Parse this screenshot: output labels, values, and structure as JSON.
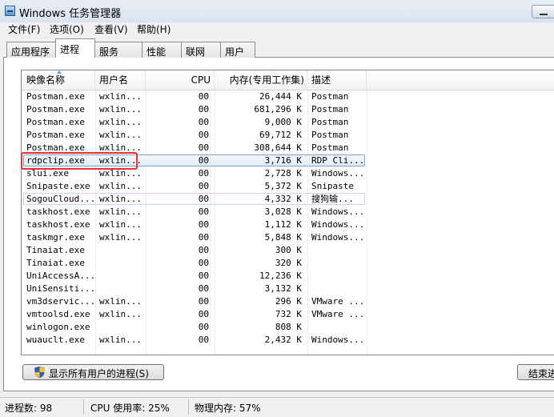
{
  "window": {
    "title": "Windows 任务管理器"
  },
  "menu": [
    "文件(F)",
    "选项(O)",
    "查看(V)",
    "帮助(H)"
  ],
  "tabs": [
    "应用程序",
    "进程",
    "服务",
    "性能",
    "联网",
    "用户"
  ],
  "active_tab": "进程",
  "columns": {
    "name": "映像名称",
    "user": "用户名",
    "cpu": "CPU",
    "mem": "内存(专用工作集)",
    "desc": "描述"
  },
  "rows": [
    {
      "name": "Postman.exe",
      "user": "wxlin...",
      "cpu": "00",
      "mem": "26,444 K",
      "desc": "Postman"
    },
    {
      "name": "Postman.exe",
      "user": "wxlin...",
      "cpu": "00",
      "mem": "681,296 K",
      "desc": "Postman"
    },
    {
      "name": "Postman.exe",
      "user": "wxlin...",
      "cpu": "00",
      "mem": "9,000 K",
      "desc": "Postman"
    },
    {
      "name": "Postman.exe",
      "user": "wxlin...",
      "cpu": "00",
      "mem": "69,712 K",
      "desc": "Postman"
    },
    {
      "name": "Postman.exe",
      "user": "wxlin...",
      "cpu": "00",
      "mem": "308,644 K",
      "desc": "Postman"
    },
    {
      "name": "rdpclip.exe",
      "user": "wxlin...",
      "cpu": "00",
      "mem": "3,716 K",
      "desc": "RDP Cli..."
    },
    {
      "name": "slui.exe",
      "user": "wxlin...",
      "cpu": "00",
      "mem": "2,728 K",
      "desc": "Windows..."
    },
    {
      "name": "Snipaste.exe",
      "user": "wxlin...",
      "cpu": "00",
      "mem": "5,372 K",
      "desc": "Snipaste"
    },
    {
      "name": "SogouCloud...",
      "user": "wxlin...",
      "cpu": "00",
      "mem": "4,332 K",
      "desc": "搜狗输..."
    },
    {
      "name": "taskhost.exe",
      "user": "wxlin...",
      "cpu": "00",
      "mem": "3,028 K",
      "desc": "Windows..."
    },
    {
      "name": "taskhost.exe",
      "user": "wxlin...",
      "cpu": "00",
      "mem": "1,112 K",
      "desc": "Windows..."
    },
    {
      "name": "taskmgr.exe",
      "user": "wxlin...",
      "cpu": "00",
      "mem": "5,848 K",
      "desc": "Windows..."
    },
    {
      "name": "Tinaiat.exe",
      "user": "",
      "cpu": "00",
      "mem": "300 K",
      "desc": ""
    },
    {
      "name": "Tinaiat.exe",
      "user": "",
      "cpu": "00",
      "mem": "320 K",
      "desc": ""
    },
    {
      "name": "UniAccessA...",
      "user": "",
      "cpu": "00",
      "mem": "12,236 K",
      "desc": ""
    },
    {
      "name": "UniSensiti...",
      "user": "",
      "cpu": "00",
      "mem": "3,132 K",
      "desc": ""
    },
    {
      "name": "vm3dservic...",
      "user": "wxlin...",
      "cpu": "00",
      "mem": "296 K",
      "desc": "VMware ..."
    },
    {
      "name": "vmtoolsd.exe",
      "user": "wxlin...",
      "cpu": "00",
      "mem": "732 K",
      "desc": "VMware ..."
    },
    {
      "name": "winlogon.exe",
      "user": "",
      "cpu": "00",
      "mem": "808 K",
      "desc": ""
    },
    {
      "name": "wuauclt.exe",
      "user": "wxlin...",
      "cpu": "00",
      "mem": "2,432 K",
      "desc": "Windows..."
    }
  ],
  "buttons": {
    "show_all": "显示所有用户的进程(S)",
    "end_process": "结束进"
  },
  "status": {
    "processes": "进程数: 98",
    "cpu": "CPU 使用率: 25%",
    "memory": "物理内存: 57%"
  },
  "colors": {
    "highlight_box": "#e8342e",
    "selection_border": "#7da2ce"
  }
}
